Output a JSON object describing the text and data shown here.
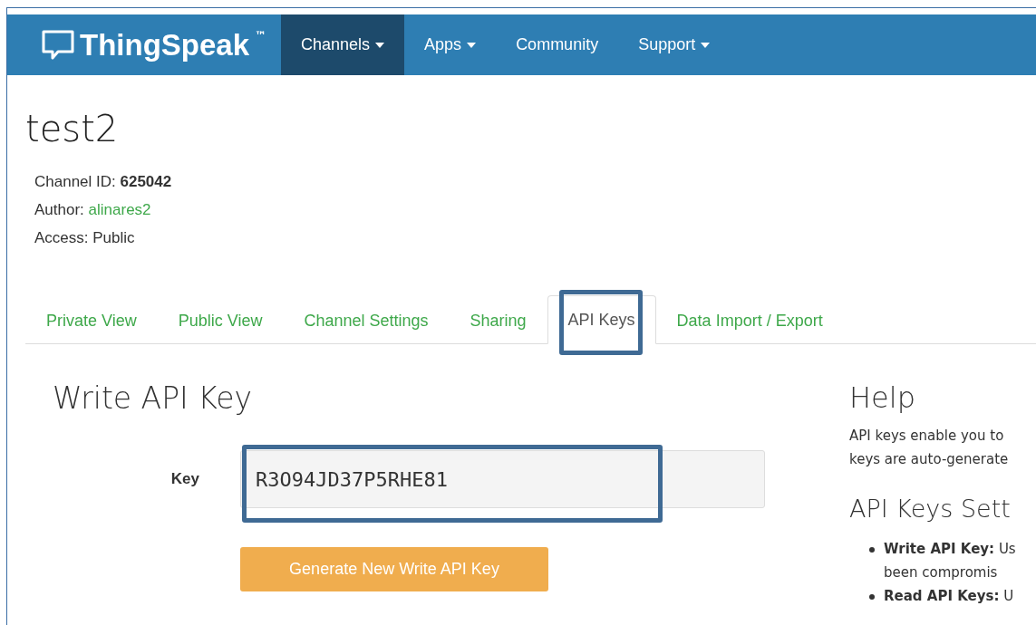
{
  "navbar": {
    "brand": "ThingSpeak",
    "trademark": "™",
    "items": [
      {
        "label": "Channels",
        "dropdown": true,
        "selected": true
      },
      {
        "label": "Apps",
        "dropdown": true,
        "selected": false
      },
      {
        "label": "Community",
        "dropdown": false,
        "selected": false
      },
      {
        "label": "Support",
        "dropdown": true,
        "selected": false
      }
    ]
  },
  "channel": {
    "title": "test2",
    "info": [
      {
        "label": "Channel ID: ",
        "value": "625042",
        "kind": "bold"
      },
      {
        "label": "Author: ",
        "value": "alinares2",
        "kind": "link"
      },
      {
        "label": "Access: ",
        "value": "Public",
        "kind": "plain"
      }
    ]
  },
  "tabs": [
    {
      "label": "Private View",
      "selected": false,
      "highlighted": false
    },
    {
      "label": "Public View",
      "selected": false,
      "highlighted": false
    },
    {
      "label": "Channel Settings",
      "selected": false,
      "highlighted": false
    },
    {
      "label": "Sharing",
      "selected": false,
      "highlighted": false
    },
    {
      "label": "API Keys",
      "selected": true,
      "highlighted": true
    },
    {
      "label": "Data Import / Export",
      "selected": false,
      "highlighted": false
    }
  ],
  "write_key": {
    "heading": "Write API Key",
    "label": "Key",
    "value": "R3O94JD37P5RHE81",
    "highlighted": true,
    "button": "Generate New Write API Key"
  },
  "help": {
    "heading": "Help",
    "lines": [
      "API keys enable you to",
      "keys are auto-generate"
    ],
    "subheading": "API Keys Sett",
    "items": [
      {
        "lines": [
          "**Write API Key:** Us",
          "been compromis"
        ]
      },
      {
        "lines": [
          "**Read API Keys:** U"
        ]
      }
    ]
  }
}
